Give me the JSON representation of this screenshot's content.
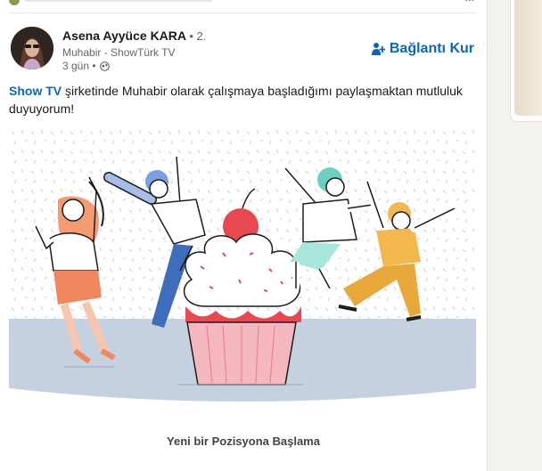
{
  "post": {
    "author_name": "Asena Ayyüce KARA",
    "degree": "• 2.",
    "headline": "Muhabir - ShowTürk TV",
    "time": "3 gün •",
    "connect_label": "Bağlantı Kur",
    "text_link": "Show TV",
    "text_body": " şirketinde Muhabir olarak çalışmaya başladığımı paylaşmaktan mutluluk duyuyorum!",
    "image_caption": "Yeni bir Pozisyona Başlama"
  },
  "icons": {
    "connect": "add-person-icon",
    "visibility": "globe-icon"
  },
  "colors": {
    "link_blue": "#0a66c2",
    "cupcake_cherry": "#e8484f",
    "cupcake_wrapper": "#f6b8c0",
    "floor": "#c6d1df"
  }
}
